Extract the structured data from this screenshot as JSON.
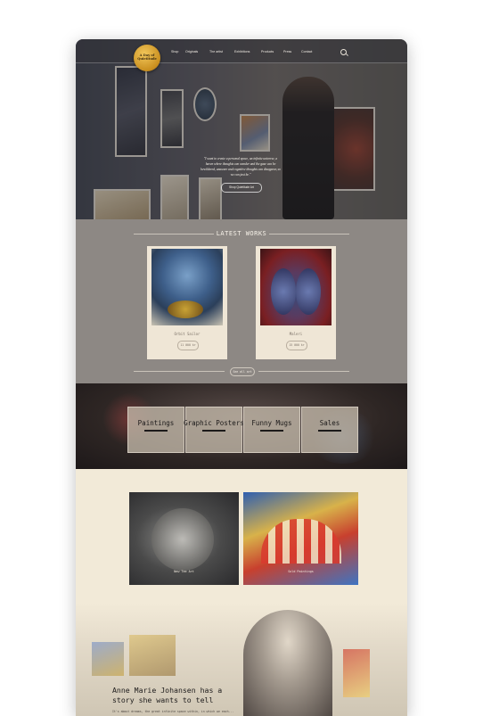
{
  "nav": {
    "logo_text": [
      "A Day of",
      "Quietitude"
    ],
    "items": [
      "Shop",
      "Originals",
      "The artist",
      "Exhibitions",
      "Products",
      "Press",
      "Contact"
    ]
  },
  "hero": {
    "quote_lines": [
      "\"I want to create a personal space, an infinite universe, a",
      "haven where thoughts can wander and the gaze can be",
      "bewildered, unaware and cognitive thoughts can disappear, so",
      "we can just be.\""
    ],
    "button": "Shop Quietitude Art"
  },
  "latest": {
    "title": "LATEST WORKS",
    "cards": [
      {
        "title": "Orbit Sailor",
        "price": "11 000 kr"
      },
      {
        "title": "Maleri",
        "price": "15 000 kr"
      }
    ],
    "see_all": "See all art"
  },
  "categories": [
    "Paintings",
    "Graphic Posters",
    "Funny Mugs",
    "Sales"
  ],
  "features": [
    "New Tee Art",
    "Sold Paintings"
  ],
  "about": {
    "title": "Anne Marie Johansen has a story she wants to tell",
    "text": "It's about dreams, the great infinite space within, in which we each..."
  }
}
